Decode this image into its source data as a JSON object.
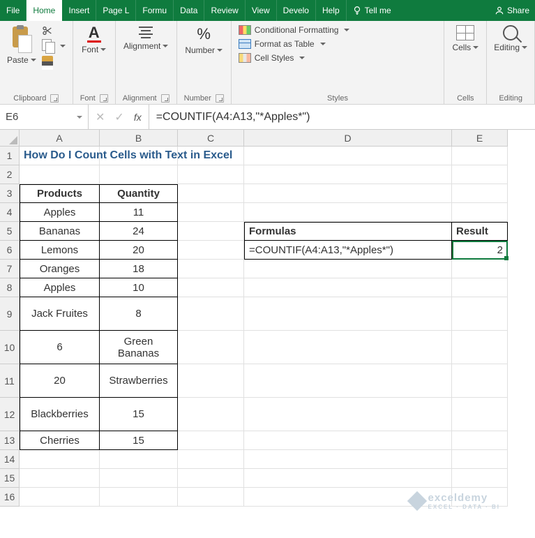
{
  "tabs": {
    "file": "File",
    "home": "Home",
    "insert": "Insert",
    "pagel": "Page L",
    "formu": "Formu",
    "data": "Data",
    "review": "Review",
    "view": "View",
    "develo": "Develo",
    "help": "Help",
    "tellme": "Tell me",
    "share": "Share"
  },
  "ribbon": {
    "clipboard": {
      "paste": "Paste",
      "label": "Clipboard"
    },
    "font": {
      "btn": "Font",
      "label": "Font"
    },
    "alignment": {
      "btn": "Alignment",
      "label": "Alignment"
    },
    "number": {
      "btn": "Number",
      "label": "Number"
    },
    "styles": {
      "cond": "Conditional Formatting",
      "table": "Format as Table",
      "cell": "Cell Styles",
      "label": "Styles"
    },
    "cells": {
      "btn": "Cells",
      "label": "Cells"
    },
    "editing": {
      "btn": "Editing",
      "label": "Editing"
    }
  },
  "fbar": {
    "name": "E6",
    "formula": "=COUNTIF(A4:A13,\"*Apples*\")"
  },
  "columns": [
    "A",
    "B",
    "C",
    "D",
    "E"
  ],
  "rows": [
    "1",
    "2",
    "3",
    "4",
    "5",
    "6",
    "7",
    "8",
    "9",
    "10",
    "11",
    "12",
    "13",
    "14",
    "15",
    "16"
  ],
  "title": "How Do I Count Cells with Text in Excel",
  "table": {
    "h1": "Products",
    "h2": "Quantity",
    "r4a": "Apples",
    "r4b": "11",
    "r5a": "Bananas",
    "r5b": "24",
    "r6a": "Lemons",
    "r6b": "20",
    "r7a": "Oranges",
    "r7b": "18",
    "r8a": "Apples",
    "r8b": "10",
    "r9a": "Jack Fruites",
    "r9b": "8",
    "r10a": "6",
    "r10b": "Green Bananas",
    "r11a": "20",
    "r11b": "Strawberries",
    "r12a": "Blackberries",
    "r12b": "15",
    "r13a": "Cherries",
    "r13b": "15"
  },
  "side": {
    "h1": "Formulas",
    "h2": "Result",
    "formula": "=COUNTIF(A4:A13,\"*Apples*\")",
    "result": "2"
  },
  "watermark": {
    "text": "exceldemy",
    "sub": "EXCEL · DATA · BI"
  }
}
